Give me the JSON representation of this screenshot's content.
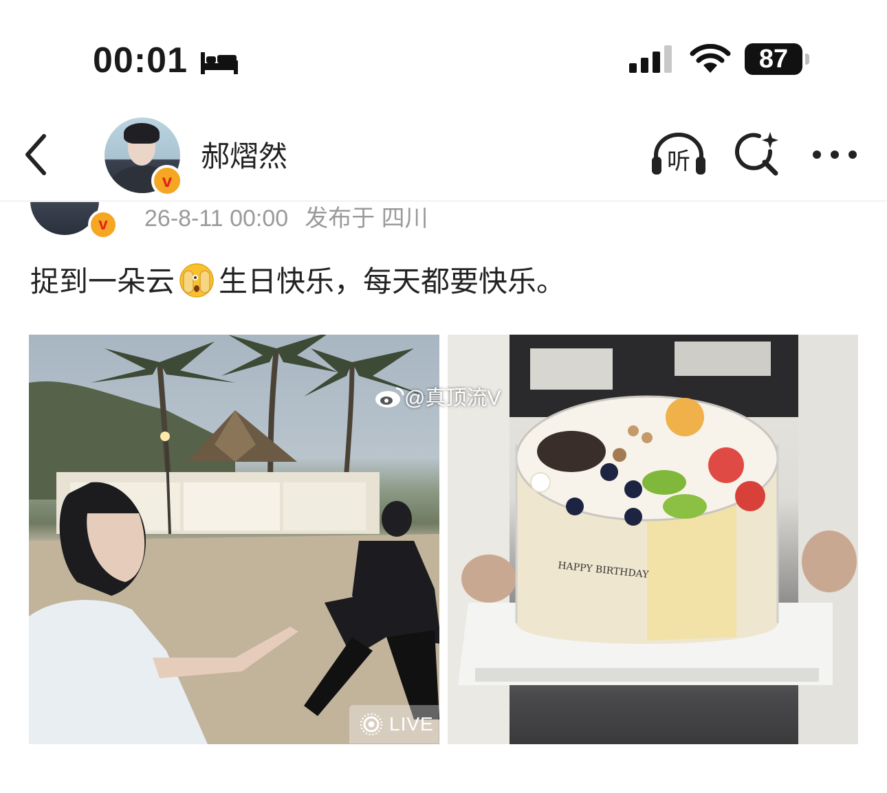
{
  "status_bar": {
    "time": "00:01",
    "battery": "87",
    "icons": [
      "sleep-focus-icon",
      "cellular-signal-icon",
      "wifi-icon",
      "battery-icon"
    ]
  },
  "nav": {
    "user_name": "郝熠然",
    "listen_label": "听",
    "icons": [
      "back-chevron-icon",
      "verified-v-icon",
      "listen-headphones-icon",
      "search-sparkle-icon",
      "more-dots-icon"
    ]
  },
  "post": {
    "timestamp": "26-8-11 00:00",
    "location": "发布于 四川",
    "text_before_emoji": "捉到一朵云",
    "text_after_emoji": "生日快乐，每天都要快乐。",
    "emoji": "face-with-peeking-eye-emoji"
  },
  "photos": [
    {
      "watermark": "@真顶流V",
      "live_label": "LIVE"
    },
    {
      "cake_text": "HAPPY BIRTHDAY"
    }
  ],
  "colors": {
    "verified_badge": "#f5a623",
    "verified_v": "#e2231a",
    "meta_text": "#9a9a9a"
  }
}
